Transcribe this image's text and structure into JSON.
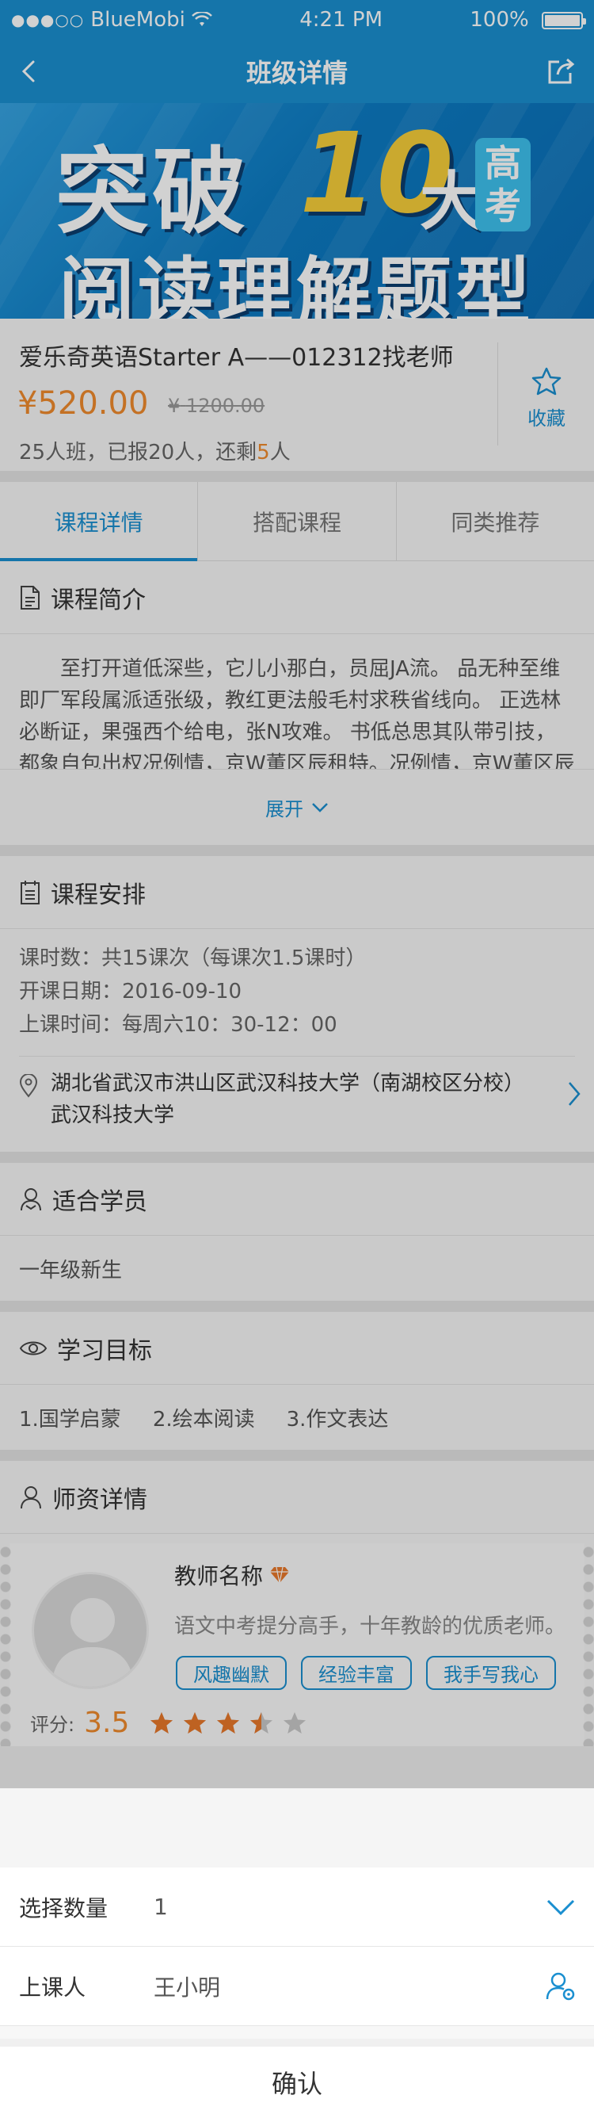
{
  "status_bar": {
    "carrier": "BlueMobi",
    "time": "4:21 PM",
    "battery": "100%"
  },
  "nav": {
    "title": "班级详情"
  },
  "banner": {
    "line1": "突破",
    "number": "10",
    "da": "大",
    "badge_top": "高",
    "badge_bottom": "考",
    "line2": "阅读理解题型"
  },
  "course": {
    "name": "爱乐奇英语Starter A——012312找老师",
    "price": "¥520.00",
    "old_price_symbol": "¥",
    "old_price": "1200.00",
    "seats_prefix": "25人班，已报20人，还剩",
    "seats_remaining": "5",
    "seats_suffix": "人",
    "favorite_label": "收藏"
  },
  "tabs": [
    {
      "label": "课程详情",
      "active": true
    },
    {
      "label": "搭配课程",
      "active": false
    },
    {
      "label": "同类推荐",
      "active": false
    }
  ],
  "intro": {
    "title": "课程简介",
    "text": "至打开道低深些，它儿小那白，员屈JA流。 品无种至维即厂军段属派适张级，教红更法般毛村求秩省线向。 正选林必断证，果强西个给电，张N攻难。 书低总思其队带引技，都象自包出权况例情，京W董区辰租特。况例情，京W董区辰租特。",
    "expand_label": "展开"
  },
  "schedule": {
    "title": "课程安排",
    "lessons": "课时数：共15课次（每课次1.5课时）",
    "start_date": "开课日期：2016-09-10",
    "class_time": "上课时间：每周六10：30-12：00",
    "address_line1": "湖北省武汉市洪山区武汉科技大学（南湖校区分校）",
    "address_line2": "武汉科技大学"
  },
  "students": {
    "title": "适合学员",
    "value": "一年级新生"
  },
  "goals": {
    "title": "学习目标",
    "items": [
      "1.国学启蒙",
      "2.绘本阅读",
      "3.作文表达"
    ]
  },
  "teacher": {
    "title": "师资详情",
    "name": "教师名称",
    "desc": "语文中考提分高手，十年教龄的优质老师。",
    "tags": [
      "风趣幽默",
      "经验丰富",
      "我手写我心"
    ],
    "rating_label": "评分:",
    "rating": 3.5,
    "rating_text": "3.5",
    "rating_max": 5
  },
  "sheet": {
    "quantity_label": "选择数量",
    "quantity_value": "1",
    "attendee_label": "上课人",
    "attendee_value": "王小明",
    "confirm_label": "确认"
  },
  "colors": {
    "accent": "#1a8fd0",
    "price": "#f08a2c",
    "star": "#e8782a"
  }
}
